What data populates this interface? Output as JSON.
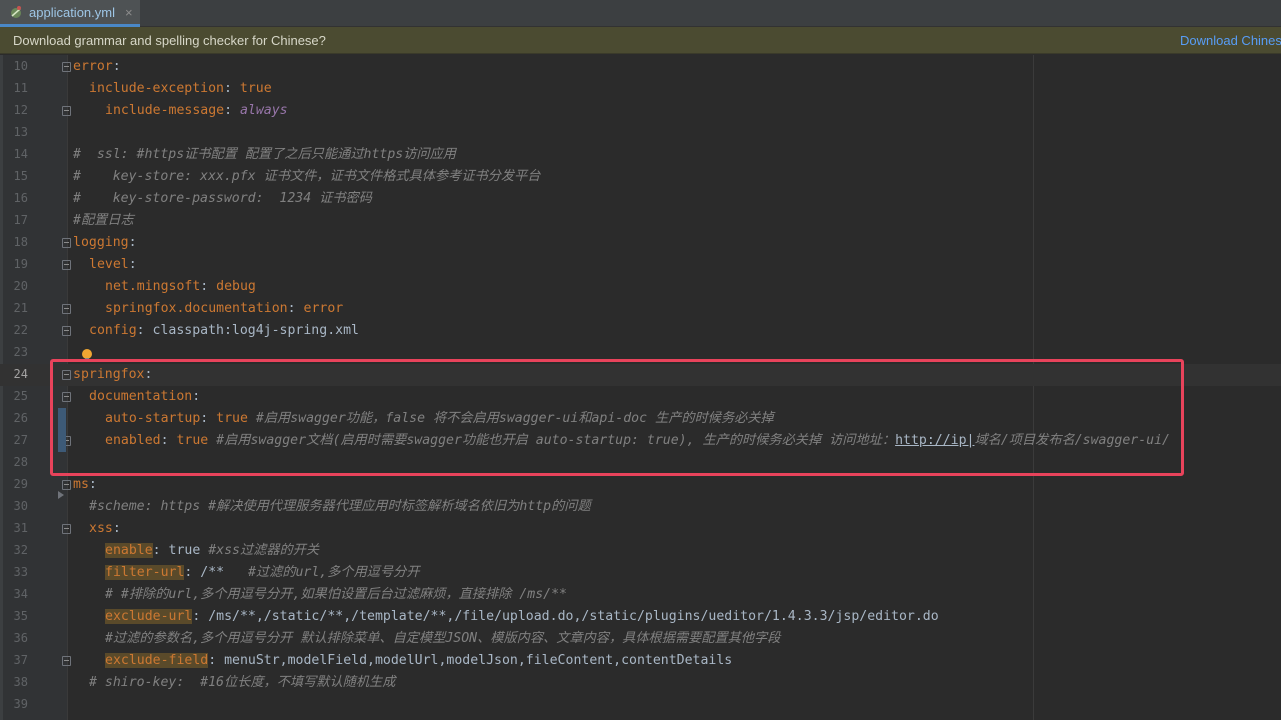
{
  "tab": {
    "label": "application.yml",
    "close": "×"
  },
  "banner": {
    "text": "Download grammar and spelling checker for Chinese?",
    "link": "Download Chines"
  },
  "colors": {
    "highlight_box": "#e8435b",
    "keyword": "#cc7832",
    "comment": "#808080",
    "string": "#9876aa"
  },
  "lines": [
    {
      "n": "10",
      "tokens": [
        [
          "k",
          "error"
        ],
        [
          "v",
          ":"
        ]
      ]
    },
    {
      "n": "11",
      "tokens": [
        [
          "k",
          "include-exception"
        ],
        [
          "v",
          ": "
        ],
        [
          "b",
          "true"
        ]
      ]
    },
    {
      "n": "12",
      "tokens": [
        [
          "k",
          "include-message"
        ],
        [
          "v",
          ": "
        ],
        [
          "i",
          "always"
        ]
      ]
    },
    {
      "n": "13",
      "tokens": []
    },
    {
      "n": "14",
      "tokens": [
        [
          "c",
          "#  ssl: #https证书配置 配置了之后只能通过https访问应用"
        ]
      ]
    },
    {
      "n": "15",
      "tokens": [
        [
          "c",
          "#    key-store: xxx.pfx 证书文件，证书文件格式具体参考证书分发平台"
        ]
      ]
    },
    {
      "n": "16",
      "tokens": [
        [
          "c",
          "#    key-store-password:  1234 证书密码"
        ]
      ]
    },
    {
      "n": "17",
      "tokens": [
        [
          "c",
          "#配置日志"
        ]
      ]
    },
    {
      "n": "18",
      "tokens": [
        [
          "k",
          "logging"
        ],
        [
          "v",
          ":"
        ]
      ]
    },
    {
      "n": "19",
      "tokens": [
        [
          "k",
          "level"
        ],
        [
          "v",
          ":"
        ]
      ]
    },
    {
      "n": "20",
      "tokens": [
        [
          "k",
          "net.mingsoft"
        ],
        [
          "v",
          ": "
        ],
        [
          "b",
          "debug"
        ]
      ]
    },
    {
      "n": "21",
      "tokens": [
        [
          "k",
          "springfox.documentation"
        ],
        [
          "v",
          ": "
        ],
        [
          "b",
          "error"
        ]
      ]
    },
    {
      "n": "22",
      "tokens": [
        [
          "k",
          "config"
        ],
        [
          "v",
          ": classpath:log4j-spring.xml"
        ]
      ]
    },
    {
      "n": "23",
      "tokens": []
    },
    {
      "n": "24",
      "tokens": [
        [
          "k",
          "springfox"
        ],
        [
          "v",
          ":"
        ]
      ]
    },
    {
      "n": "25",
      "tokens": [
        [
          "k",
          "documentation"
        ],
        [
          "v",
          ":"
        ]
      ]
    },
    {
      "n": "26",
      "tokens": [
        [
          "k",
          "auto-startup"
        ],
        [
          "v",
          ": "
        ],
        [
          "b",
          "true "
        ],
        [
          "c",
          "#启用swagger功能，false 将不会启用swagger-ui和api-doc 生产的时候务必关掉"
        ]
      ]
    },
    {
      "n": "27",
      "tokens": [
        [
          "k",
          "enabled"
        ],
        [
          "v",
          ": "
        ],
        [
          "b",
          "true "
        ],
        [
          "c",
          "#启用swagger文档(启用时需要swagger功能也开启 auto-startup: true), 生产的时候务必关掉 访问地址："
        ],
        [
          "u",
          "http://ip|"
        ],
        [
          "c",
          "域名/项目发布名/swagger-ui/"
        ]
      ]
    },
    {
      "n": "28",
      "tokens": []
    },
    {
      "n": "29",
      "tokens": [
        [
          "k",
          "ms"
        ],
        [
          "v",
          ":"
        ]
      ]
    },
    {
      "n": "30",
      "tokens": [
        [
          "c",
          "#scheme: https #解决使用代理服务器代理应用时标签解析域名依旧为http的问题"
        ]
      ]
    },
    {
      "n": "31",
      "tokens": [
        [
          "k",
          "xss"
        ],
        [
          "v",
          ":"
        ]
      ]
    },
    {
      "n": "32",
      "tokens": [
        [
          "hl",
          "enable"
        ],
        [
          "v",
          ": true "
        ],
        [
          "c",
          "#xss过滤器的开关"
        ]
      ]
    },
    {
      "n": "33",
      "tokens": [
        [
          "hl",
          "filter-url"
        ],
        [
          "v",
          ": /**   "
        ],
        [
          "c",
          "#过滤的url,多个用逗号分开"
        ]
      ]
    },
    {
      "n": "34",
      "tokens": [
        [
          "c",
          "# #排除的url,多个用逗号分开,如果怕设置后台过滤麻烦，直接排除 /ms/**"
        ]
      ]
    },
    {
      "n": "35",
      "tokens": [
        [
          "hl",
          "exclude-url"
        ],
        [
          "v",
          ": /ms/**,/static/**,/template/**,/file/upload.do,/static/plugins/ueditor/1.4.3.3/jsp/editor.do"
        ]
      ]
    },
    {
      "n": "36",
      "tokens": [
        [
          "c",
          "#过滤的参数名,多个用逗号分开 默认排除菜单、自定模型JSON、模版内容、文章内容，具体根据需要配置其他字段"
        ]
      ]
    },
    {
      "n": "37",
      "tokens": [
        [
          "hl",
          "exclude-field"
        ],
        [
          "v",
          ": menuStr,modelField,modelUrl,modelJson,fileContent,contentDetails"
        ]
      ]
    },
    {
      "n": "38",
      "tokens": [
        [
          "c",
          "# shiro-key:  #16位长度，不填写默认随机生成"
        ]
      ]
    },
    {
      "n": "39",
      "tokens": []
    }
  ]
}
